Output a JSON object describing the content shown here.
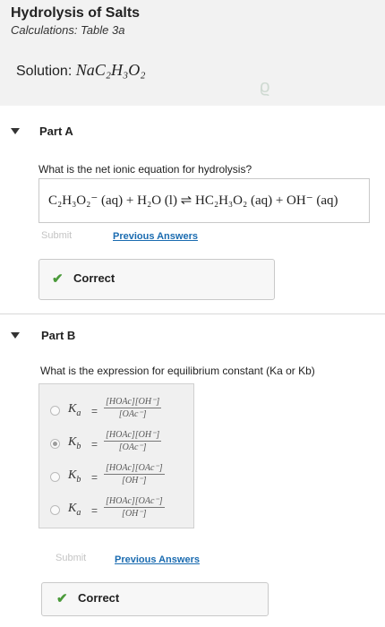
{
  "header": {
    "title": "Hydrolysis of Salts",
    "subtitle": "Calculations: Table 3a",
    "solution_label": "Solution:",
    "solution_formula": "NaC₂H₃O₂"
  },
  "part_a": {
    "label": "Part A",
    "question": "What is the net ionic equation for hydrolysis?",
    "answer": "C₂H₃O₂⁻ (aq) + H₂O (l) ⇌ HC₂H₃O₂ (aq) + OH⁻ (aq)",
    "submit_label": "Submit",
    "previous_answers_label": "Previous Answers",
    "status": "Correct"
  },
  "part_b": {
    "label": "Part B",
    "question": "What is the expression for equilibrium constant (Ka or Kb)",
    "options": [
      {
        "k": "Ka",
        "eq": "=",
        "num": "[HOAc][OH⁻]",
        "den": "[OAc⁻]",
        "selected": false
      },
      {
        "k": "Kb",
        "eq": "=",
        "num": "[HOAc][OH⁻]",
        "den": "[OAc⁻]",
        "selected": true
      },
      {
        "k": "Kb",
        "eq": "=",
        "num": "[HOAc][OAc⁻]",
        "den": "[OH⁻]",
        "selected": false
      },
      {
        "k": "Ka",
        "eq": "=",
        "num": "[HOAc][OAc⁻]",
        "den": "[OH⁻]",
        "selected": false
      }
    ],
    "submit_label": "Submit",
    "previous_answers_label": "Previous Answers",
    "status": "Correct"
  },
  "colors": {
    "link": "#1a6bb0",
    "check": "#4a9a3a",
    "disabled": "#c4c4c4"
  }
}
